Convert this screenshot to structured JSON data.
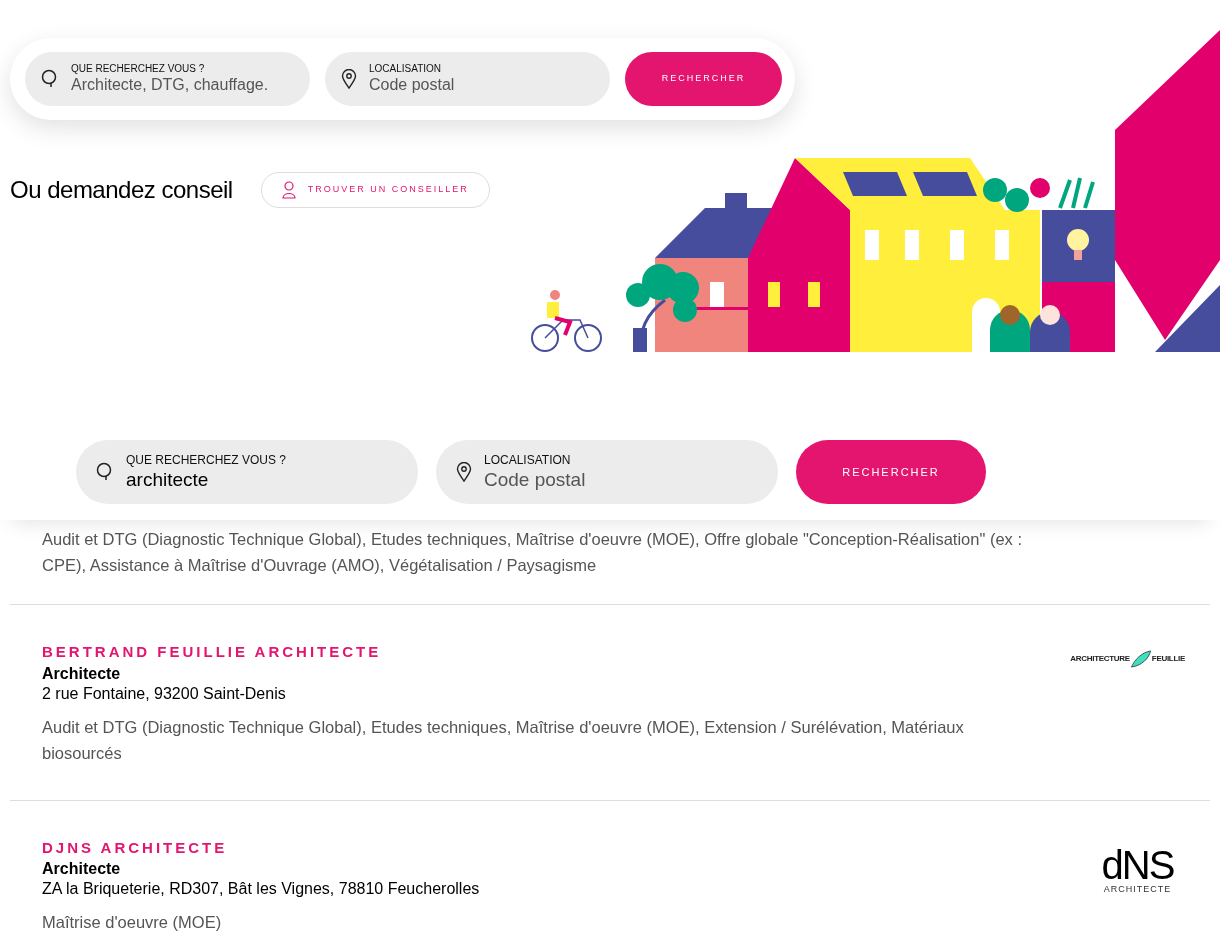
{
  "top_search": {
    "fields": [
      {
        "kind": "search",
        "label": "QUE RECHERCHEZ VOUS ?",
        "placeholder": "Architecte, DTG, chauffage."
      },
      {
        "kind": "location",
        "label": "LOCALISATION",
        "placeholder": "Code postal"
      }
    ],
    "button": "RECHERCHER"
  },
  "advice": {
    "heading": "Ou demandez conseil",
    "button": "TROUVER UN CONSEILLER"
  },
  "results_search": {
    "fields": [
      {
        "kind": "search",
        "label": "QUE RECHERCHEZ VOUS ?",
        "value": "architecte"
      },
      {
        "kind": "location",
        "label": "LOCALISATION",
        "placeholder": "Code postal"
      }
    ],
    "button": "RECHERCHER"
  },
  "results": [
    {
      "services": "Audit et DTG (Diagnostic Technique Global), Etudes techniques, Maîtrise d'oeuvre (MOE), Offre globale \"Conception-Réalisation\" (ex : CPE), Assistance à Maîtrise d'Ouvrage (AMO), Végétalisation / Paysagisme"
    },
    {
      "name": "BERTRAND FEUILLIE ARCHITECTE",
      "category": "Architecte",
      "address": "2 rue Fontaine, 93200 Saint-Denis",
      "services": "Audit et DTG (Diagnostic Technique Global), Etudes techniques, Maîtrise d'oeuvre (MOE), Extension / Surélévation, Matériaux biosourcés",
      "logo": {
        "kind": "feather",
        "texts": [
          "ARCHITECTURE",
          "FEUILLIE"
        ]
      }
    },
    {
      "name": "DJNS ARCHITECTE",
      "category": "Architecte",
      "address": "ZA la Briqueterie, RD307, Bât les Vignes, 78810 Feucherolles",
      "services": "Maîtrise d'oeuvre (MOE)",
      "logo": {
        "kind": "monogram",
        "texts": [
          "dNS",
          "ARCHITECTE"
        ]
      }
    }
  ]
}
